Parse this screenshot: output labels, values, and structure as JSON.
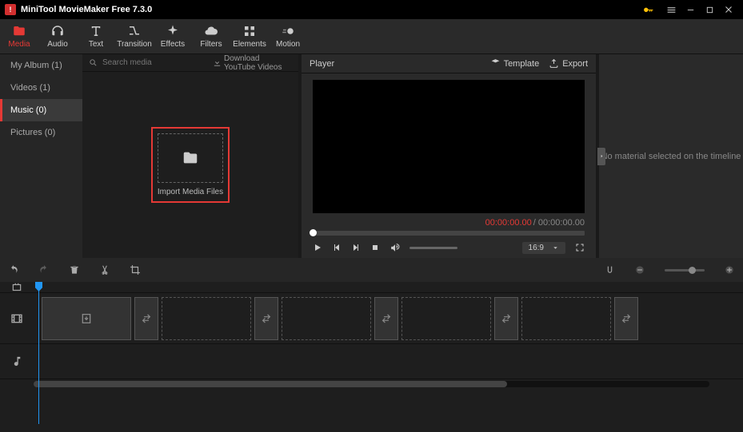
{
  "app": {
    "title": "MiniTool MovieMaker Free 7.3.0"
  },
  "toolbar": {
    "tabs": [
      {
        "label": "Media",
        "icon": "folder"
      },
      {
        "label": "Audio",
        "icon": "headphones"
      },
      {
        "label": "Text",
        "icon": "text"
      },
      {
        "label": "Transition",
        "icon": "transition"
      },
      {
        "label": "Effects",
        "icon": "sparkle"
      },
      {
        "label": "Filters",
        "icon": "cloud"
      },
      {
        "label": "Elements",
        "icon": "grid"
      },
      {
        "label": "Motion",
        "icon": "motion"
      }
    ]
  },
  "sidebar": {
    "items": [
      {
        "label": "My Album (1)"
      },
      {
        "label": "Videos (1)"
      },
      {
        "label": "Music (0)"
      },
      {
        "label": "Pictures (0)"
      }
    ]
  },
  "search": {
    "placeholder": "Search media",
    "download_label": "Download YouTube Videos"
  },
  "import": {
    "label": "Import Media Files"
  },
  "player": {
    "title": "Player",
    "template_label": "Template",
    "export_label": "Export",
    "time_current": "00:00:00.00",
    "time_total": "/ 00:00:00.00",
    "ratio": "16:9"
  },
  "info": {
    "message": "No material selected on the timeline"
  }
}
